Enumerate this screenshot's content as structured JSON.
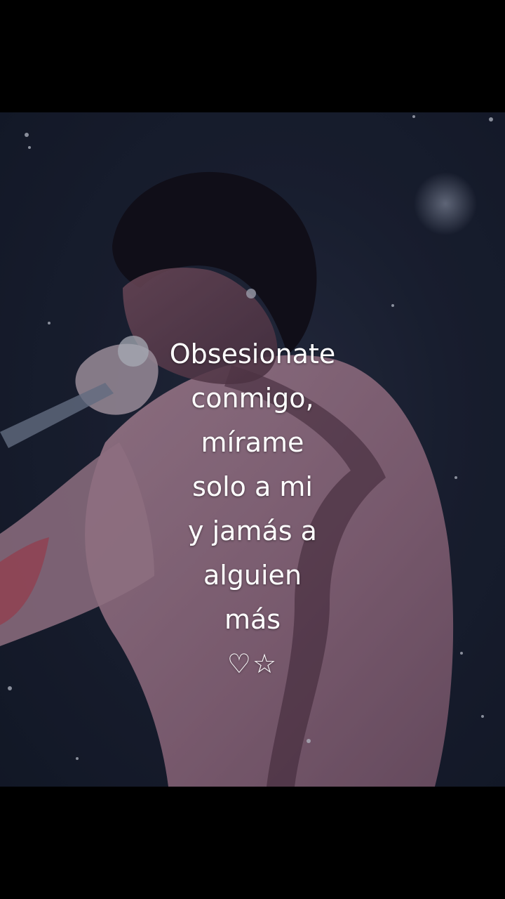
{
  "overlay_text": {
    "lines": [
      "Obsesionate",
      "conmigo,",
      "mírame",
      "solo a mi",
      "y jamás a",
      "alguien",
      "más"
    ],
    "symbols": "♡☆"
  },
  "colors": {
    "background": "#000000",
    "scene_dark": "#1c2233",
    "jacket_pink": "#b88a9c",
    "text": "#ffffff"
  }
}
